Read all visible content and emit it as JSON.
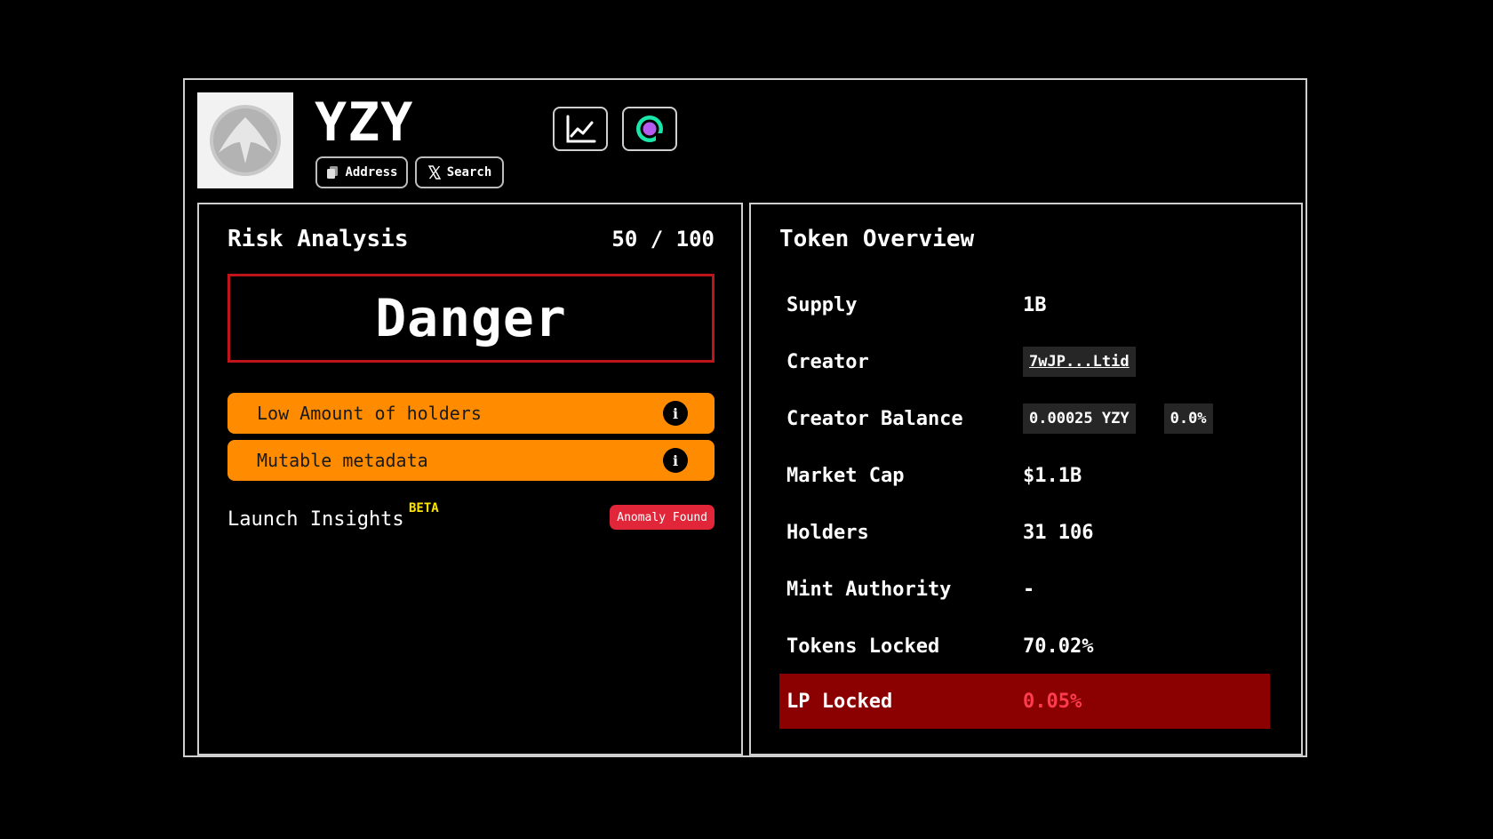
{
  "header": {
    "token_name": "YZY",
    "address_label": "Address",
    "search_label": "Search"
  },
  "risk": {
    "title": "Risk Analysis",
    "score": "50 / 100",
    "level": "Danger",
    "warnings": [
      "Low Amount of holders",
      "Mutable metadata"
    ],
    "launch_label": "Launch Insights",
    "beta_label": "BETA",
    "anomaly_label": "Anomaly Found"
  },
  "overview": {
    "title": "Token Overview",
    "supply_label": "Supply",
    "supply_value": "1B",
    "creator_label": "Creator",
    "creator_value": "7wJP...Ltid",
    "creator_balance_label": "Creator Balance",
    "creator_balance_value": "0.00025 YZY",
    "creator_balance_pct": "0.0%",
    "market_cap_label": "Market Cap",
    "market_cap_value": "$1.1B",
    "holders_label": "Holders",
    "holders_value": "31 106",
    "mint_label": "Mint Authority",
    "mint_value": "-",
    "tokens_locked_label": "Tokens Locked",
    "tokens_locked_value": "70.02%",
    "lp_locked_label": "LP Locked",
    "lp_locked_value": "0.05%"
  },
  "colors": {
    "danger_border": "#c0141c",
    "warning_bg": "#ff8c00",
    "anomaly_bg": "#e02638",
    "beta": "#ffe500",
    "lp_row_bg": "#8b0000",
    "lp_value": "#ff3b50"
  },
  "icons": {
    "logo": "token-logo-icon",
    "address": "copy-icon",
    "search": "x-logo-icon",
    "chart": "line-chart-icon",
    "scan": "scan-logo-icon",
    "info": "info-icon"
  }
}
